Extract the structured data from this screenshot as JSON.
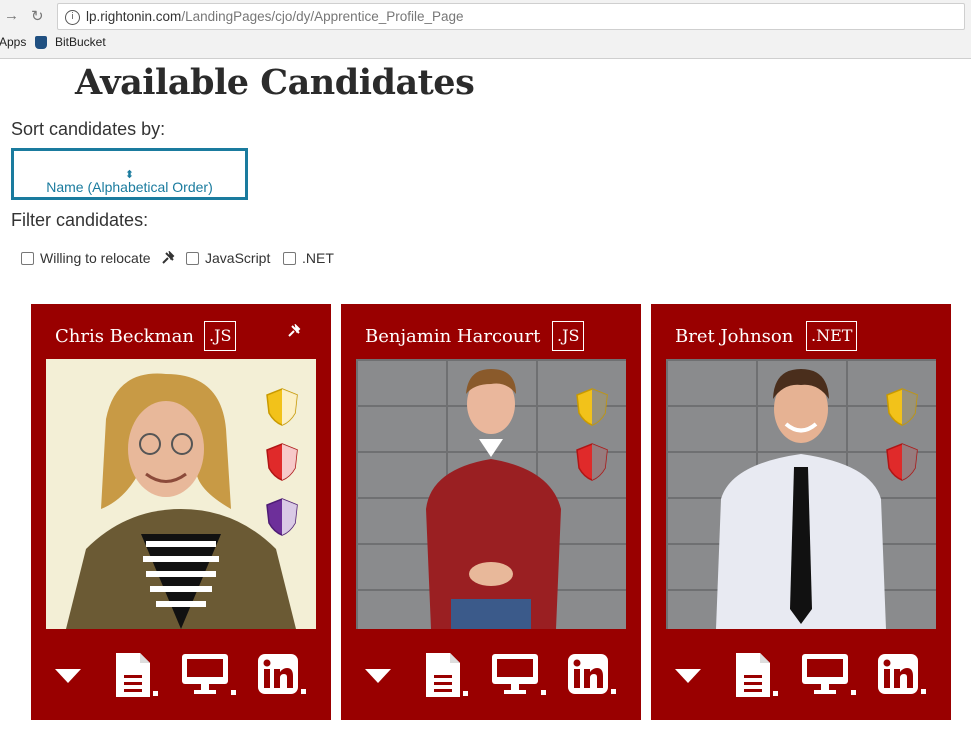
{
  "browser": {
    "url_host": "lp.rightonin.com",
    "url_path": "/LandingPages/cjo/dy/Apprentice_Profile_Page",
    "bookmarks": [
      "Apps",
      "BitBucket"
    ]
  },
  "page": {
    "title": "Available Candidates",
    "sort_label": "Sort candidates by:",
    "sort_value": "Name (Alphabetical Order)",
    "filter_label": "Filter candidates:",
    "filters": [
      {
        "label": "Willing to relocate",
        "checked": false
      },
      {
        "label": "JavaScript",
        "checked": false
      },
      {
        "label": ".NET",
        "checked": false
      }
    ]
  },
  "candidates": [
    {
      "name": "Chris Beckman",
      "tag": ".JS",
      "relocate": true,
      "badges": [
        "gold",
        "red",
        "purple"
      ]
    },
    {
      "name": "Benjamin Harcourt",
      "tag": ".JS",
      "relocate": false,
      "badges": [
        "gold",
        "red"
      ]
    },
    {
      "name": "Bret Johnson",
      "tag": ".NET",
      "relocate": false,
      "badges": [
        "gold",
        "red"
      ]
    }
  ],
  "colors": {
    "card": "#990000",
    "accent": "#1a7b9e",
    "gold": "#f2c21a",
    "red": "#e02a2a",
    "purple": "#6d2f9a"
  },
  "icons": [
    "chevron-down-icon",
    "resume-icon",
    "portfolio-icon",
    "linkedin-icon",
    "relocate-icon"
  ]
}
